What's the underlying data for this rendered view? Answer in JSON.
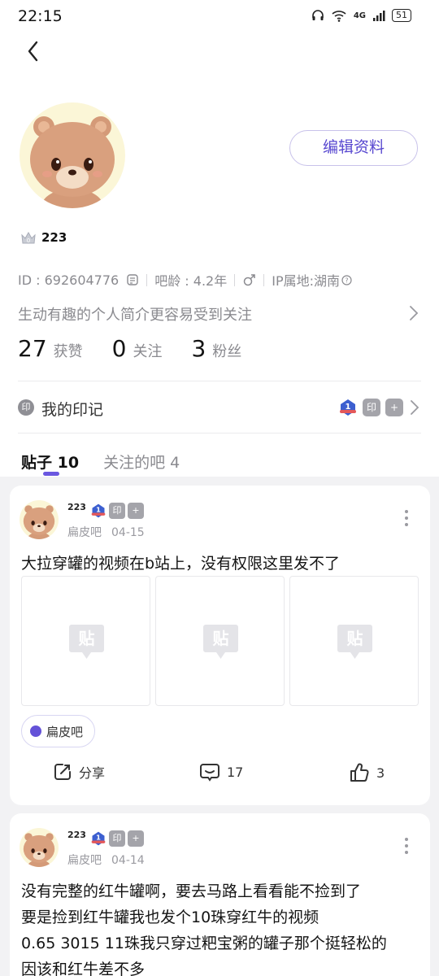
{
  "status": {
    "time": "22:15",
    "network": "4G",
    "battery": "51"
  },
  "profile": {
    "edit_label": "编辑资料",
    "name": "223",
    "id_text": "ID : 692604776",
    "age_text": "吧龄 : 4.2年",
    "ip_text": "IP属地:湖南",
    "bio_placeholder": "生动有趣的个人简介更容易受到关注"
  },
  "stats": [
    {
      "num": "27",
      "label": "获赞"
    },
    {
      "num": "0",
      "label": "关注"
    },
    {
      "num": "3",
      "label": "粉丝"
    }
  ],
  "badges": {
    "label": "我的印记",
    "seal_char": "印",
    "plus_char": "+",
    "level": "1"
  },
  "tabs": [
    {
      "label": "贴子 10"
    },
    {
      "label": "关注的吧 4"
    }
  ],
  "posts": [
    {
      "user": "223",
      "forum": "扁皮吧",
      "date": "04-15",
      "text": "大拉穿罐的视频在b站上，没有权限这里发不了",
      "chip": "扁皮吧",
      "share": "分享",
      "comments": "17",
      "likes": "3"
    },
    {
      "user": "223",
      "forum": "扁皮吧",
      "date": "04-14",
      "lines": [
        "没有完整的红牛罐啊，要去马路上看看能不捡到了",
        "要是捡到红牛罐我也发个10珠穿红牛的视频",
        "0.65 3015 11珠我只穿过粑宝粥的罐子那个挺轻松的",
        "因该和红牛差不多"
      ]
    }
  ],
  "placeholder_glyph": "贴",
  "colors": {
    "accent": "#6a57e0",
    "text_gray": "#8a8a8f"
  }
}
